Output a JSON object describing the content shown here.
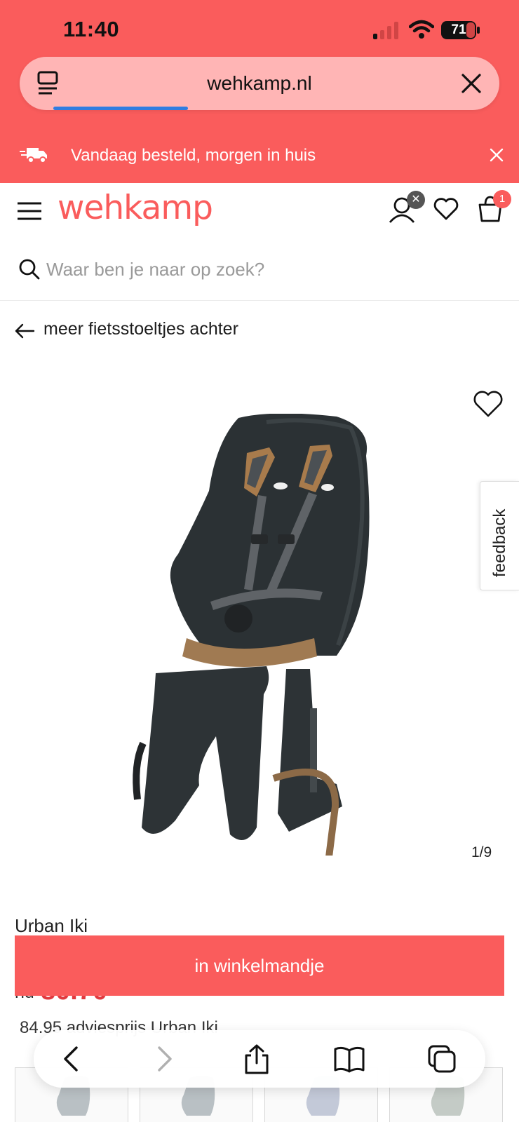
{
  "status_bar": {
    "time": "11:40",
    "battery_level": "71"
  },
  "browser": {
    "url": "wehkamp.nl",
    "load_progress": 0.28
  },
  "promo_bar": {
    "text": "Vandaag besteld, morgen in huis"
  },
  "header": {
    "logo": "wehkamp",
    "cart_count": "1",
    "account_badge": "✕"
  },
  "search": {
    "placeholder": "Waar ben je naar op zoek?"
  },
  "back_link": {
    "label": "meer fietsstoeltjes achter"
  },
  "gallery": {
    "counter": "1/9"
  },
  "feedback": {
    "label": "feedback"
  },
  "product": {
    "brand": "Urban Iki",
    "price_label": "nu",
    "price_now": "80.70",
    "advice_price": "84.95",
    "advice_text": "adviesprijs Urban Iki"
  },
  "actions": {
    "add_to_cart": "in winkelmandje"
  },
  "colors": {
    "brand": "#fa5c5c",
    "price": "#e13a3f",
    "progress": "#2f7de1"
  },
  "icons": [
    "menu-icon",
    "close-icon",
    "truck-icon",
    "hamburger-icon",
    "account-icon",
    "heart-icon",
    "cart-icon",
    "search-icon",
    "arrow-left-icon",
    "chevron-left-icon",
    "chevron-right-icon",
    "share-icon",
    "book-icon",
    "tabs-icon"
  ]
}
